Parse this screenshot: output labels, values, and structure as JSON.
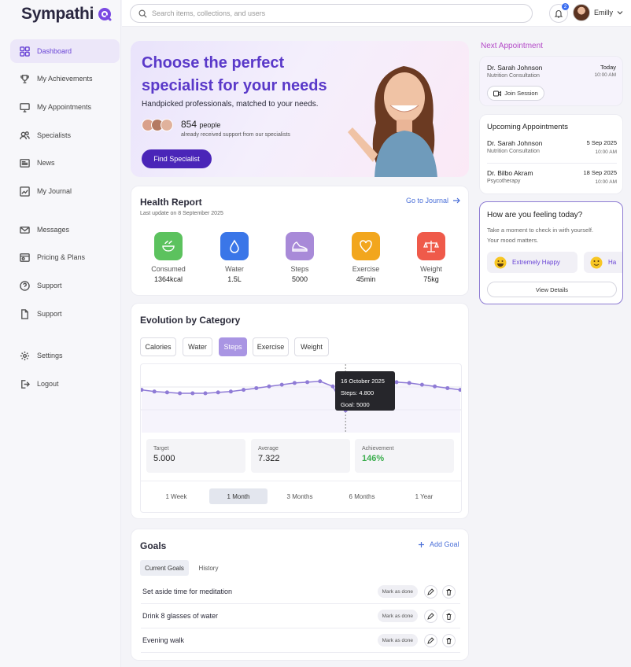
{
  "app": {
    "name": "Sympathi"
  },
  "search": {
    "placeholder": "Search items, collections, and users"
  },
  "notifications": {
    "count": "2"
  },
  "user": {
    "name": "Emilly"
  },
  "sidebar": {
    "items": [
      {
        "label": "Dashboard",
        "icon": "grid-icon"
      },
      {
        "label": "My Achievements",
        "icon": "trophy-icon"
      },
      {
        "label": "My Appointments",
        "icon": "monitor-icon"
      },
      {
        "label": "Specialists",
        "icon": "users-icon"
      },
      {
        "label": "News",
        "icon": "newspaper-icon"
      },
      {
        "label": "My Journal",
        "icon": "chart-icon"
      },
      {
        "label": "Messages",
        "icon": "mail-icon"
      },
      {
        "label": "Pricing & Plans",
        "icon": "card-icon"
      },
      {
        "label": "Support",
        "icon": "help-icon"
      },
      {
        "label": "Support",
        "icon": "document-icon"
      },
      {
        "label": "Settings",
        "icon": "gear-icon"
      },
      {
        "label": "Logout",
        "icon": "logout-icon"
      }
    ]
  },
  "hero": {
    "title_line1": "Choose the perfect",
    "title_line2": "specialist for your needs",
    "subtitle": "Handpicked professionals, matched to your needs.",
    "count": "854",
    "count_unit": "people",
    "count_sub": "already received support from our specialists",
    "button": "Find Specialist"
  },
  "health": {
    "title": "Health Report",
    "updated": "Last update on 8 September 2025",
    "link": "Go to Journal",
    "metrics": [
      {
        "label": "Consumed",
        "value": "1364kcal",
        "color": "#5cc25e",
        "icon": "bowl-icon"
      },
      {
        "label": "Water",
        "value": "1.5L",
        "color": "#3a76e8",
        "icon": "drop-icon"
      },
      {
        "label": "Steps",
        "value": "5000",
        "color": "#a88ad8",
        "icon": "shoe-icon"
      },
      {
        "label": "Exercise",
        "value": "45min",
        "color": "#f2a61d",
        "icon": "heart-icon"
      },
      {
        "label": "Weight",
        "value": "75kg",
        "color": "#ef5a4a",
        "icon": "scale-icon"
      }
    ]
  },
  "evolution": {
    "title": "Evolution by Category",
    "tabs": [
      "Calories",
      "Water",
      "Steps",
      "Exercise",
      "Weight"
    ],
    "active_tab": "Steps",
    "tooltip": {
      "date": "16 October 2025",
      "steps": "Steps: 4.800",
      "goal": "Goal: 5000"
    },
    "stats": [
      {
        "label": "Target",
        "value": "5.000"
      },
      {
        "label": "Average",
        "value": "7.322"
      },
      {
        "label": "Achievement",
        "value": "146%"
      }
    ],
    "ranges": [
      "1 Week",
      "1 Month",
      "3 Months",
      "6 Months",
      "1 Year"
    ],
    "active_range": "1 Month"
  },
  "chart_data": {
    "type": "line",
    "title": "",
    "xlabel": "",
    "ylabel": "",
    "grid": true,
    "series": [
      {
        "values": [
          6000,
          5900,
          5850,
          5800,
          5800,
          5800,
          5850,
          5900,
          6000,
          6100,
          6200,
          6300,
          6400,
          6450,
          6500,
          6200,
          4800,
          6300,
          6400,
          6500,
          6450,
          6400,
          6300,
          6200,
          6100,
          6000
        ]
      }
    ],
    "highlight_index": 16,
    "ylim": [
      3500,
      7500
    ],
    "line_color": "#8f7bd6"
  },
  "goals": {
    "title": "Goals",
    "add": "Add Goal",
    "tabs": [
      "Current Goals",
      "History"
    ],
    "mark_label": "Mark as done",
    "items": [
      "Set aside time for meditation",
      "Drink 8 glasses of water",
      "Evening walk"
    ]
  },
  "next_appt": {
    "heading": "Next Appointment",
    "name": "Dr. Sarah Johnson",
    "type": "Nutrition Consultation",
    "day": "Today",
    "time": "10:00 AM",
    "button": "Join Session"
  },
  "upcoming": {
    "title": "Upcoming Appointments",
    "items": [
      {
        "name": "Dr. Sarah Johnson",
        "type": "Nutrition Consultation",
        "date": "5 Sep 2025",
        "time": "10:00 AM"
      },
      {
        "name": "Dr. Bilbo Akram",
        "type": "Psycotherapy",
        "date": "18 Sep 2025",
        "time": "10:00 AM"
      }
    ]
  },
  "mood": {
    "title": "How are you feeling today?",
    "sub1": "Take a moment to check in with yourself.",
    "sub2": "Your mood matters.",
    "options": [
      "Extremely Happy",
      "Ha"
    ],
    "button": "View Details"
  }
}
